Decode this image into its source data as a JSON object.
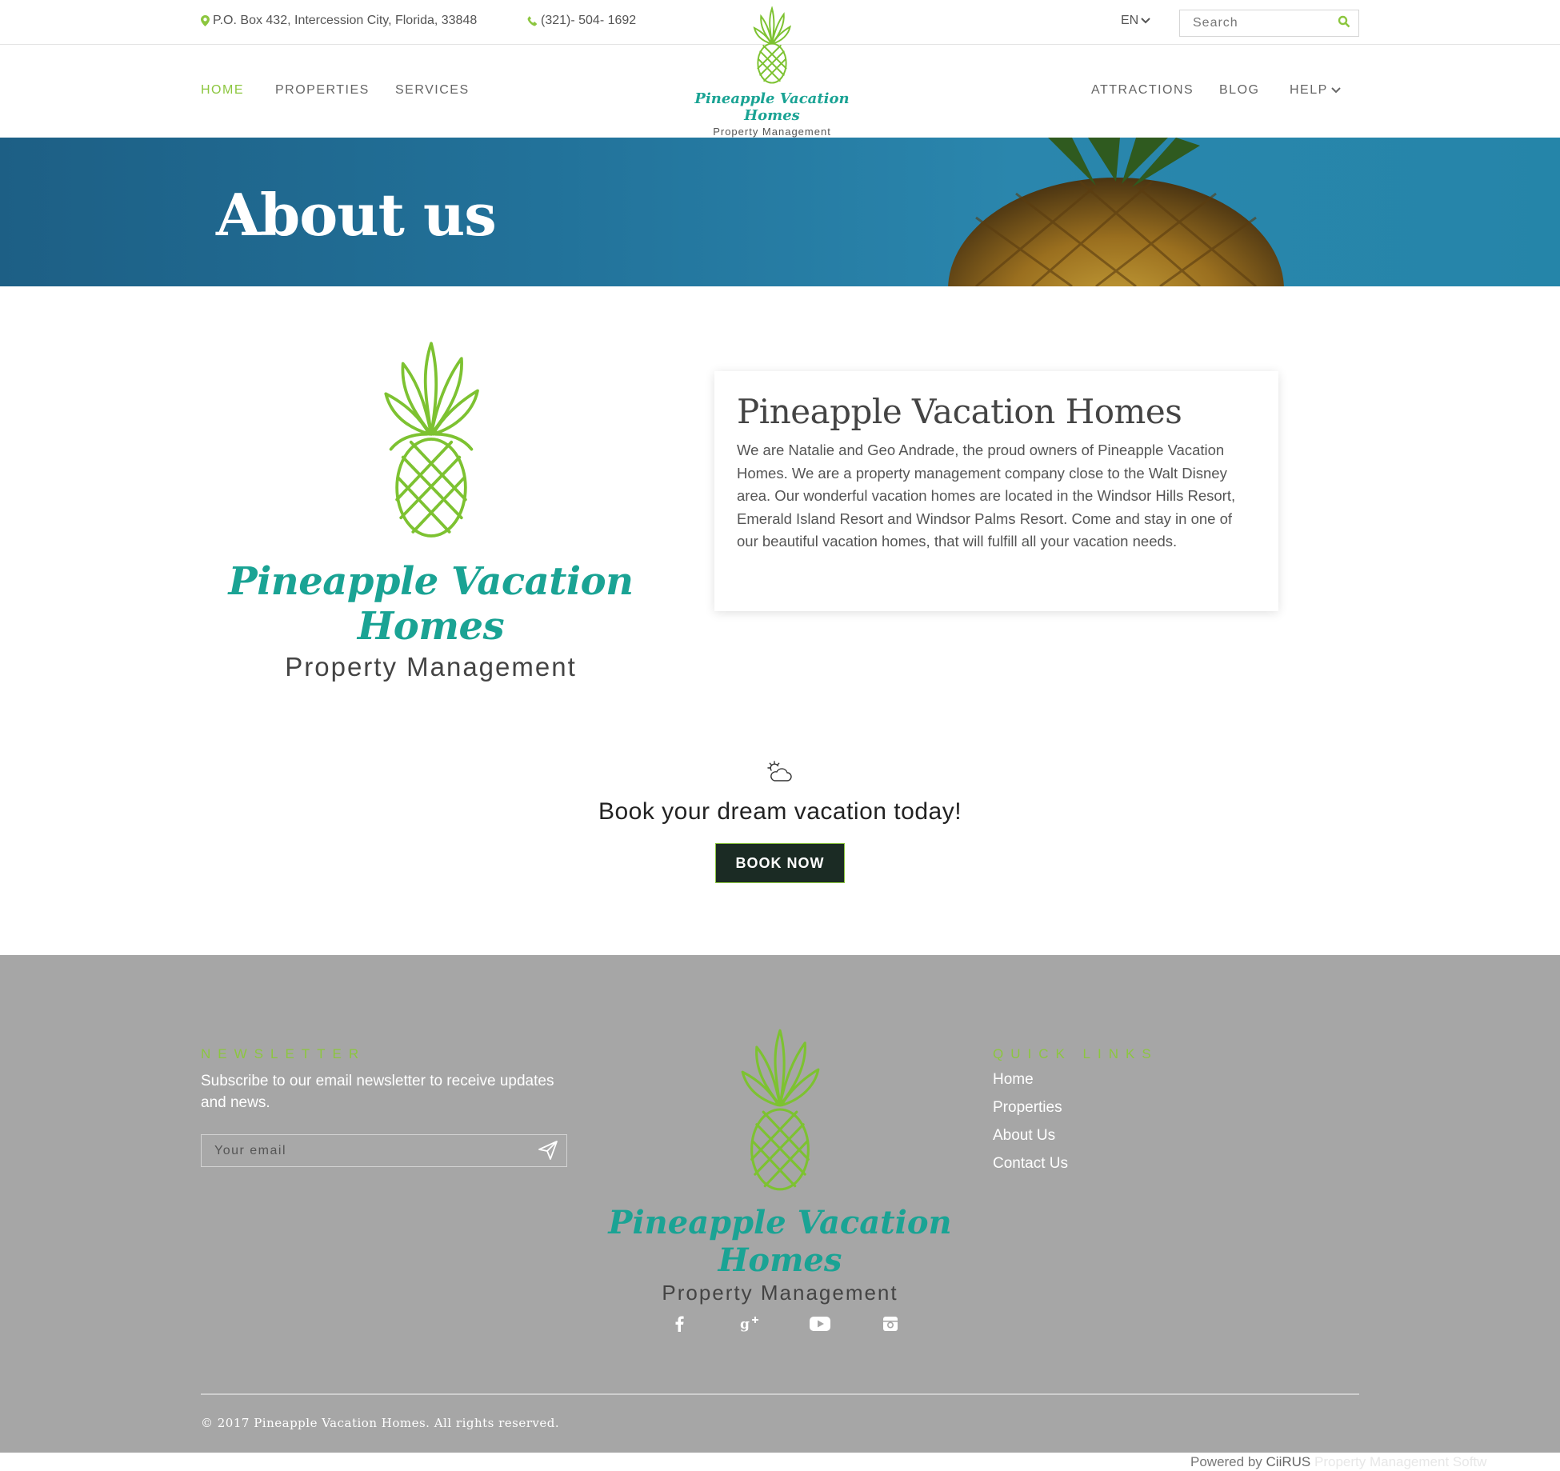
{
  "topbar": {
    "address": "P.O. Box 432, Intercession City, Florida, 33848",
    "phone": "(321)- 504- 1692",
    "language": "EN",
    "search_placeholder": "Search"
  },
  "nav": {
    "left": [
      "HOME",
      "PROPERTIES",
      "SERVICES"
    ],
    "right": [
      "ATTRACTIONS",
      "BLOG",
      "HELP"
    ]
  },
  "brand": {
    "name": "Pineapple Vacation Homes",
    "tagline": "Property Management"
  },
  "hero": {
    "title": "About us"
  },
  "about": {
    "heading": "Pineapple Vacation Homes",
    "body": "We are Natalie and Geo Andrade, the proud owners of Pineapple Vacation Homes. We are a property management company close to the Walt Disney area. Our wonderful vacation homes are located in the Windsor Hills Resort, Emerald Island Resort and Windsor Palms Resort. Come and stay in one of our beautiful vacation homes, that will fulfill all your vacation needs."
  },
  "cta": {
    "title": "Book your dream vacation today!",
    "button": "BOOK NOW"
  },
  "footer": {
    "newsletter_heading": "NEWSLETTER",
    "newsletter_text": "Subscribe to our email newsletter to receive updates and news.",
    "email_placeholder": "Your email",
    "links_heading": "QUICK LINKS",
    "links": [
      "Home",
      "Properties",
      "About Us",
      "Contact Us"
    ],
    "copyright": "© 2017 Pineapple Vacation Homes. All rights reserved."
  },
  "powered": {
    "prefix": "Powered by",
    "brand": "CiiRUS",
    "suffix": "Property Management Softw"
  },
  "colors": {
    "accent_green": "#8cc63f",
    "brand_teal": "#1aa394",
    "button_dark": "#1b2b24",
    "footer_gray": "#a6a6a6"
  },
  "icons": [
    "map-marker-icon",
    "phone-icon",
    "chevron-down-icon",
    "search-icon",
    "pineapple-logo-icon",
    "sun-cloud-icon",
    "send-icon",
    "facebook-icon",
    "google-plus-icon",
    "youtube-icon",
    "instagram-icon"
  ]
}
